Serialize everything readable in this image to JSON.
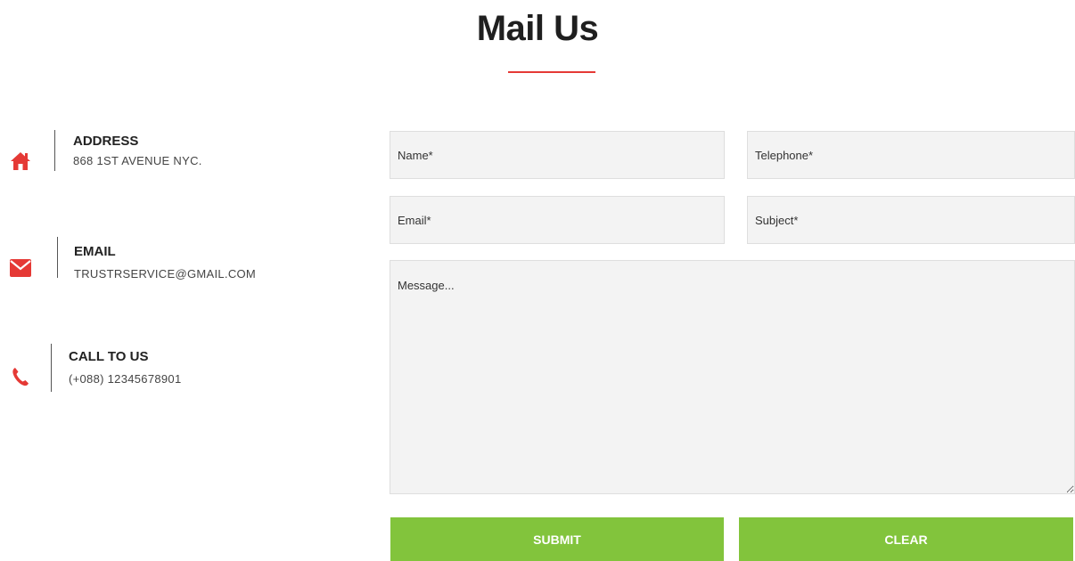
{
  "section": {
    "title": "Mail Us"
  },
  "contact_info": {
    "address": {
      "label": "ADDRESS",
      "value": "868 1ST AVENUE NYC.",
      "icon": "home-icon"
    },
    "email": {
      "label": "EMAIL",
      "value": "TRUSTRSERVICE@GMAIL.COM",
      "icon": "envelope-icon"
    },
    "phone": {
      "label": "CALL TO US",
      "value": "(+088) 12345678901",
      "icon": "phone-icon"
    }
  },
  "form": {
    "name_placeholder": "Name*",
    "telephone_placeholder": "Telephone*",
    "email_placeholder": "Email*",
    "subject_placeholder": "Subject*",
    "message_placeholder": "Message...",
    "submit_label": "SUBMIT",
    "clear_label": "CLEAR"
  },
  "colors": {
    "accent_red": "#e53935",
    "button_green": "#82c43c"
  }
}
